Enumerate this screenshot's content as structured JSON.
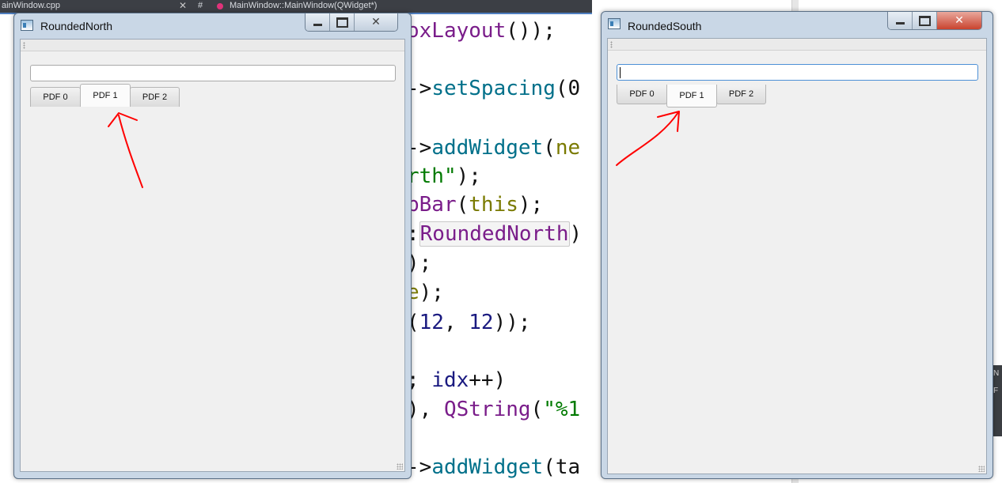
{
  "ide": {
    "tabs": [
      {
        "label": "ainWindow.cpp"
      },
      {
        "label": "MainWindow::MainWindow(QWidget*)"
      }
    ],
    "tab_separator": "#",
    "code": [
      {
        "parts": [
          {
            "t": "oxLayout",
            "c": "k-purple"
          },
          {
            "t": "());",
            "c": "k-black"
          }
        ]
      },
      {
        "parts": [
          {
            "t": "->",
            "c": "k-black"
          },
          {
            "t": "setSpacing",
            "c": "k-teal"
          },
          {
            "t": "(0",
            "c": "k-black"
          }
        ]
      },
      {
        "parts": [
          {
            "t": "->",
            "c": "k-black"
          },
          {
            "t": "addWidget",
            "c": "k-teal"
          },
          {
            "t": "(",
            "c": "k-black"
          },
          {
            "t": "ne",
            "c": "k-olive"
          }
        ]
      },
      {
        "parts": [
          {
            "t": "rth\"",
            "c": "k-green"
          },
          {
            "t": ");",
            "c": "k-black"
          }
        ]
      },
      {
        "parts": [
          {
            "t": "bBar",
            "c": "k-purple"
          },
          {
            "t": "(",
            "c": "k-black"
          },
          {
            "t": "this",
            "c": "k-olive"
          },
          {
            "t": ");",
            "c": "k-black"
          }
        ]
      },
      {
        "parts": [
          {
            "t": ":",
            "c": "k-black"
          },
          {
            "t": "RoundedNorth",
            "c": "k-purple hl-box"
          },
          {
            "t": ")",
            "c": "k-black"
          }
        ]
      },
      {
        "parts": [
          {
            "t": ");",
            "c": "k-black"
          }
        ]
      },
      {
        "parts": [
          {
            "t": "e",
            "c": "k-olive"
          },
          {
            "t": ");",
            "c": "k-black"
          }
        ]
      },
      {
        "parts": [
          {
            "t": "(",
            "c": "k-black"
          },
          {
            "t": "12",
            "c": "k-navy"
          },
          {
            "t": ", ",
            "c": "k-black"
          },
          {
            "t": "12",
            "c": "k-navy"
          },
          {
            "t": "));",
            "c": "k-black"
          }
        ]
      },
      {
        "parts": [
          {
            "t": "; ",
            "c": "k-black"
          },
          {
            "t": "idx",
            "c": "k-navy"
          },
          {
            "t": "++)",
            "c": "k-black"
          }
        ]
      },
      {
        "parts": [
          {
            "t": "), ",
            "c": "k-black"
          },
          {
            "t": "QString",
            "c": "k-purple"
          },
          {
            "t": "(",
            "c": "k-black"
          },
          {
            "t": "\"%1",
            "c": "k-green"
          }
        ]
      },
      {
        "parts": [
          {
            "t": "->",
            "c": "k-black"
          },
          {
            "t": "addWidget",
            "c": "k-teal"
          },
          {
            "t": "(ta",
            "c": "k-black"
          }
        ]
      }
    ],
    "side_panel": [
      "N",
      "F"
    ]
  },
  "north_window": {
    "title": "RoundedNorth",
    "tabs": [
      "PDF 0",
      "PDF 1",
      "PDF 2"
    ],
    "selected_tab": "PDF 1",
    "search_value": ""
  },
  "south_window": {
    "title": "RoundedSouth",
    "tabs": [
      "PDF 0",
      "PDF 1",
      "PDF 2"
    ],
    "selected_tab": "PDF 1",
    "search_value": ""
  },
  "colors": {
    "accent_focus": "#4d90d6",
    "arrow": "#ff0000",
    "window_frame": "#c9d7e6"
  }
}
